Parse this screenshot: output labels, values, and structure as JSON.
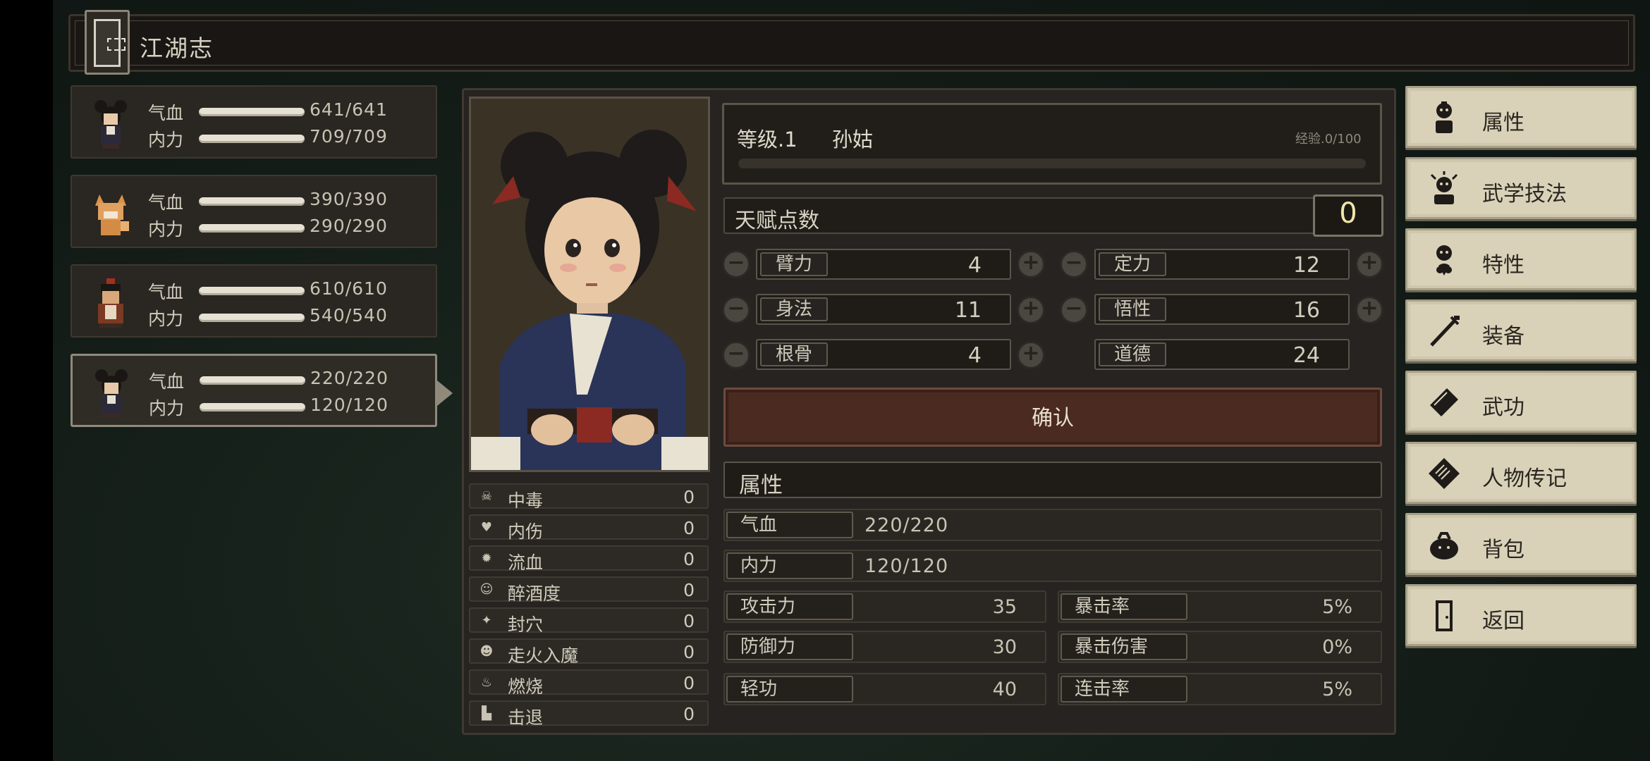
{
  "title": "江湖志",
  "party": [
    {
      "hp_label": "气血",
      "hp": "641/641",
      "mp_label": "内力",
      "mp": "709/709",
      "avatar": "bun-hair-girl-sprite",
      "selected": false
    },
    {
      "hp_label": "气血",
      "hp": "390/390",
      "mp_label": "内力",
      "mp": "290/290",
      "avatar": "fox-sprite",
      "selected": false
    },
    {
      "hp_label": "气血",
      "hp": "610/610",
      "mp_label": "内力",
      "mp": "540/540",
      "avatar": "warrior-sprite",
      "selected": false
    },
    {
      "hp_label": "气血",
      "hp": "220/220",
      "mp_label": "内力",
      "mp": "120/120",
      "avatar": "bun-hair-girl-sprite",
      "selected": true
    }
  ],
  "status": [
    {
      "name": "中毒",
      "value": "0",
      "icon": "skull-icon"
    },
    {
      "name": "内伤",
      "value": "0",
      "icon": "broken-heart-icon"
    },
    {
      "name": "流血",
      "value": "0",
      "icon": "blood-splat-icon"
    },
    {
      "name": "醉酒度",
      "value": "0",
      "icon": "dizzy-face-icon"
    },
    {
      "name": "封穴",
      "value": "0",
      "icon": "acupoint-icon"
    },
    {
      "name": "走火入魔",
      "value": "0",
      "icon": "demon-face-icon"
    },
    {
      "name": "燃烧",
      "value": "0",
      "icon": "flame-icon"
    },
    {
      "name": "击退",
      "value": "0",
      "icon": "boot-icon"
    }
  ],
  "character": {
    "level": "等级.1",
    "name": "孙姑",
    "exp": "经验.0/100"
  },
  "talent": {
    "label": "天赋点数",
    "value": "0"
  },
  "stats": [
    {
      "name": "臂力",
      "value": "4"
    },
    {
      "name": "定力",
      "value": "12"
    },
    {
      "name": "身法",
      "value": "11"
    },
    {
      "name": "悟性",
      "value": "16"
    },
    {
      "name": "根骨",
      "value": "4"
    },
    {
      "name": "道德",
      "value": "24"
    }
  ],
  "confirm_label": "确认",
  "attributes": {
    "header": "属性",
    "hp": {
      "label": "气血",
      "value": "220/220"
    },
    "mp": {
      "label": "内力",
      "value": "120/120"
    },
    "rows": [
      {
        "label": "攻击力",
        "value": "35",
        "label2": "暴击率",
        "value2": "5%"
      },
      {
        "label": "防御力",
        "value": "30",
        "label2": "暴击伤害",
        "value2": "0%"
      },
      {
        "label": "轻功",
        "value": "40",
        "label2": "连击率",
        "value2": "5%"
      }
    ]
  },
  "menu": [
    {
      "label": "属性",
      "icon": "character-icon"
    },
    {
      "label": "武学技法",
      "icon": "martial-skill-icon"
    },
    {
      "label": "特性",
      "icon": "trait-icon"
    },
    {
      "label": "装备",
      "icon": "sword-icon"
    },
    {
      "label": "武功",
      "icon": "manual-book-icon"
    },
    {
      "label": "人物传记",
      "icon": "biography-icon"
    },
    {
      "label": "背包",
      "icon": "bag-icon"
    },
    {
      "label": "返回",
      "icon": "exit-door-icon"
    }
  ],
  "colors": {
    "confirm_bg": "#4b2a22",
    "menu_bg": "#d9d2b9",
    "panel_bg": "#262320",
    "talent_value": "#f0e6a8"
  }
}
